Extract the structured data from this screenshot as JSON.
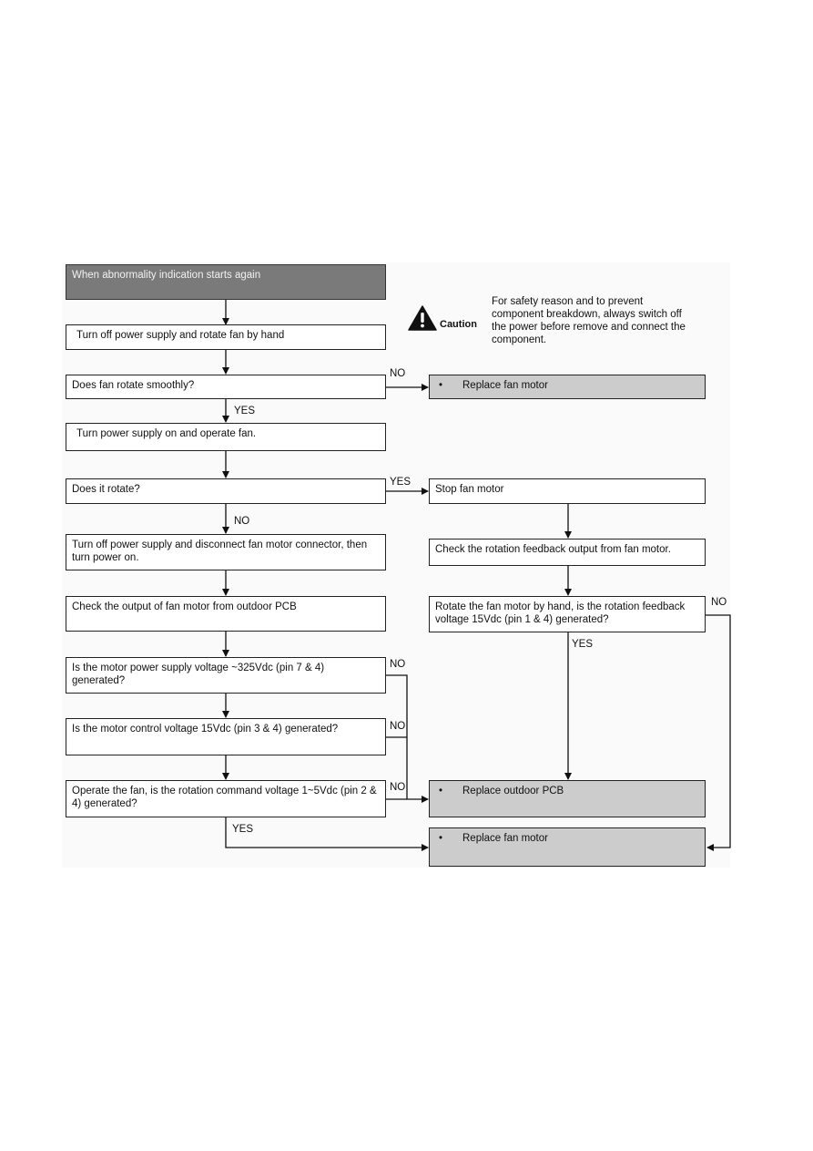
{
  "flowchart": {
    "start": "When abnormality indication starts again",
    "steps": {
      "turn_off_rotate": "Turn off power supply and rotate fan by hand",
      "rotate_smoothly": "Does fan rotate smoothly?",
      "power_on_operate": "Turn power supply on and operate fan.",
      "does_it_rotate": "Does it rotate?",
      "disconnect_connector": "Turn off power supply and disconnect fan motor connector, then turn power on.",
      "check_output": "Check the output of fan motor from outdoor PCB",
      "power_supply_voltage": "Is the motor power supply voltage ~325Vdc (pin 7 & 4) generated?",
      "control_voltage": "Is the motor control voltage 15Vdc (pin 3 & 4) generated?",
      "command_voltage": "Operate the fan, is the rotation command voltage 1~5Vdc (pin 2 & 4) generated?",
      "stop_fan": "Stop fan motor",
      "check_feedback": "Check the rotation feedback output from fan motor.",
      "feedback_voltage": "Rotate the fan motor by hand, is the rotation feedback voltage 15Vdc (pin 1 & 4) generated?"
    },
    "actions": {
      "bullet": "•",
      "replace_fan_motor_1": "Replace fan motor",
      "replace_outdoor_pcb": "Replace outdoor PCB",
      "replace_fan_motor_2": "Replace fan motor"
    },
    "labels": {
      "yes": "YES",
      "no": "NO"
    },
    "caution": {
      "word": "Caution",
      "text": "For safety reason and to prevent component breakdown, always switch off the power before remove and connect the component."
    }
  }
}
